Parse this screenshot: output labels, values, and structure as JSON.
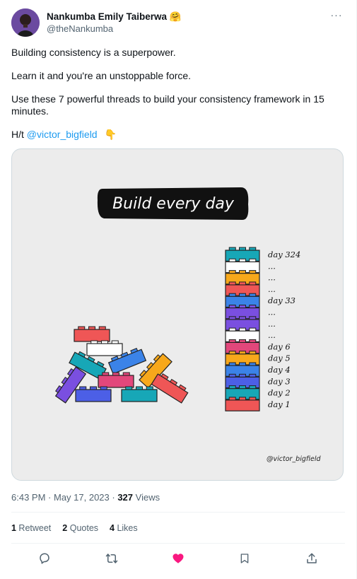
{
  "author": {
    "display_name": "Nankumba Emily Taiberwa",
    "emoji": "🤗",
    "handle": "@theNankumba"
  },
  "tweet": {
    "line1": "Building consistency is a superpower.",
    "line2": "Learn it and you're an unstoppable force.",
    "line3": "Use these 7 powerful threads to build your consistency framework in 15 minutes.",
    "ht_prefix": "H/t ",
    "ht_link": "@victor_bigfield",
    "ht_emoji": "👇"
  },
  "media": {
    "banner": "Build every day",
    "tower_labels": [
      "day 324",
      "...",
      "...",
      "...",
      "day 33",
      "...",
      "...",
      "...",
      "day 6",
      "day 5",
      "day 4",
      "day 3",
      "day 2",
      "day 1"
    ],
    "watermark": "@victor_bigfield",
    "colors": {
      "red": "#ef5656",
      "teal": "#17a7b7",
      "blue": "#3b83e8",
      "purple": "#7a4fe0",
      "orange": "#f7a81b",
      "pink": "#e2477b",
      "white": "#ffffff",
      "royal": "#4c5fe6"
    }
  },
  "meta": {
    "time": "6:43 PM",
    "sep": " · ",
    "date": "May 17, 2023",
    "views_count": "327",
    "views_label": " Views"
  },
  "stats": {
    "retweets_count": "1",
    "retweets_label": " Retweet",
    "quotes_count": "2",
    "quotes_label": " Quotes",
    "likes_count": "4",
    "likes_label": " Likes"
  },
  "icons": {
    "reply": "reply-icon",
    "retweet": "retweet-icon",
    "like": "heart-icon",
    "bookmark": "bookmark-icon",
    "share": "share-icon"
  }
}
